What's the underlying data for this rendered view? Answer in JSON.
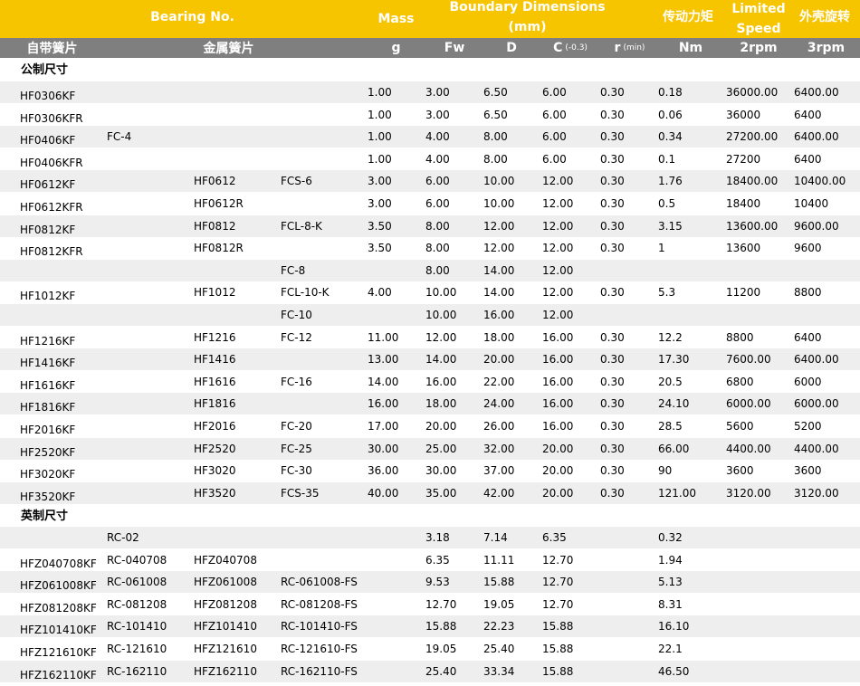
{
  "header": {
    "bearing_no": "Bearing No.",
    "mass": "Mass",
    "boundary": "Boundary Dimensions (mm)",
    "torque": "传动力矩",
    "limited_speed": "Limited Speed",
    "outer_rotation": "外壳旋转",
    "self_cage": "自带簧片",
    "metal_cage": "金属簧片",
    "unit_g": "g",
    "fw": "Fw",
    "d": "D",
    "c": "C",
    "c_tol": "(-0.3)",
    "r": "r",
    "r_min": "(min)",
    "nm": "Nm",
    "rpm2": "2rpm",
    "rpm3": "3rpm"
  },
  "sections": {
    "metric": "公制尺寸",
    "inch": "英制尺寸"
  },
  "metric_rows": [
    {
      "shade": true,
      "cells": [
        "HF0306KF",
        "",
        "",
        "",
        "1.00",
        "3.00",
        "6.50",
        "6.00",
        "0.30",
        "0.18",
        "36000.00",
        "6400.00"
      ]
    },
    {
      "shade": false,
      "cells": [
        "HF0306KFR",
        "",
        "",
        "",
        "1.00",
        "3.00",
        "6.50",
        "6.00",
        "0.30",
        "0.06",
        "36000",
        "6400"
      ]
    },
    {
      "shade": true,
      "cells": [
        "HF0406KF",
        "FC-4",
        "",
        "",
        "1.00",
        "4.00",
        "8.00",
        "6.00",
        "0.30",
        "0.34",
        "27200.00",
        "6400.00"
      ]
    },
    {
      "shade": false,
      "cells": [
        "HF0406KFR",
        "",
        "",
        "",
        "1.00",
        "4.00",
        "8.00",
        "6.00",
        "0.30",
        "0.1",
        "27200",
        "6400"
      ]
    },
    {
      "shade": true,
      "cells": [
        "HF0612KF",
        "",
        "HF0612",
        "FCS-6",
        "3.00",
        "6.00",
        "10.00",
        "12.00",
        "0.30",
        "1.76",
        "18400.00",
        "10400.00"
      ]
    },
    {
      "shade": false,
      "cells": [
        "HF0612KFR",
        "",
        "HF0612R",
        "",
        "3.00",
        "6.00",
        "10.00",
        "12.00",
        "0.30",
        "0.5",
        "18400",
        "10400"
      ]
    },
    {
      "shade": true,
      "cells": [
        "HF0812KF",
        "",
        "HF0812",
        "FCL-8-K",
        "3.50",
        "8.00",
        "12.00",
        "12.00",
        "0.30",
        "3.15",
        "13600.00",
        "9600.00"
      ]
    },
    {
      "shade": false,
      "cells": [
        "HF0812KFR",
        "",
        "HF0812R",
        "",
        "3.50",
        "8.00",
        "12.00",
        "12.00",
        "0.30",
        "1",
        "13600",
        "9600"
      ]
    },
    {
      "shade": true,
      "cells": [
        "",
        "",
        "",
        "FC-8",
        "",
        "8.00",
        "14.00",
        "12.00",
        "",
        "",
        "",
        ""
      ]
    },
    {
      "shade": false,
      "cells": [
        "HF1012KF",
        "",
        "HF1012",
        "FCL-10-K",
        "4.00",
        "10.00",
        "14.00",
        "12.00",
        "0.30",
        "5.3",
        "11200",
        "8800"
      ]
    },
    {
      "shade": true,
      "cells": [
        "",
        "",
        "",
        "FC-10",
        "",
        "10.00",
        "16.00",
        "12.00",
        "",
        "",
        "",
        ""
      ]
    },
    {
      "shade": false,
      "cells": [
        "HF1216KF",
        "",
        "HF1216",
        "FC-12",
        "11.00",
        "12.00",
        "18.00",
        "16.00",
        "0.30",
        "12.2",
        "8800",
        "6400"
      ]
    },
    {
      "shade": true,
      "cells": [
        "HF1416KF",
        "",
        "HF1416",
        "",
        "13.00",
        "14.00",
        "20.00",
        "16.00",
        "0.30",
        "17.30",
        "7600.00",
        "6400.00"
      ]
    },
    {
      "shade": false,
      "cells": [
        "HF1616KF",
        "",
        "HF1616",
        "FC-16",
        "14.00",
        "16.00",
        "22.00",
        "16.00",
        "0.30",
        "20.5",
        "6800",
        "6000"
      ]
    },
    {
      "shade": true,
      "cells": [
        "HF1816KF",
        "",
        "HF1816",
        "",
        "16.00",
        "18.00",
        "24.00",
        "16.00",
        "0.30",
        "24.10",
        "6000.00",
        "6000.00"
      ]
    },
    {
      "shade": false,
      "cells": [
        "HF2016KF",
        "",
        "HF2016",
        "FC-20",
        "17.00",
        "20.00",
        "26.00",
        "16.00",
        "0.30",
        "28.5",
        "5600",
        "5200"
      ]
    },
    {
      "shade": true,
      "cells": [
        "HF2520KF",
        "",
        "HF2520",
        "FC-25",
        "30.00",
        "25.00",
        "32.00",
        "20.00",
        "0.30",
        "66.00",
        "4400.00",
        "4400.00"
      ]
    },
    {
      "shade": false,
      "cells": [
        "HF3020KF",
        "",
        "HF3020",
        "FC-30",
        "36.00",
        "30.00",
        "37.00",
        "20.00",
        "0.30",
        "90",
        "3600",
        "3600"
      ]
    },
    {
      "shade": true,
      "cells": [
        "HF3520KF",
        "",
        "HF3520",
        "FCS-35",
        "40.00",
        "35.00",
        "42.00",
        "20.00",
        "0.30",
        "121.00",
        "3120.00",
        "3120.00"
      ]
    }
  ],
  "inch_rows": [
    {
      "shade": true,
      "cells": [
        "",
        "RC-02",
        "",
        "",
        "",
        "3.18",
        "7.14",
        "6.35",
        "",
        "0.32",
        "",
        ""
      ]
    },
    {
      "shade": false,
      "cells": [
        "HFZ040708KF",
        "RC-040708",
        "HFZ040708",
        "",
        "",
        "6.35",
        "11.11",
        "12.70",
        "",
        "1.94",
        "",
        ""
      ]
    },
    {
      "shade": true,
      "cells": [
        "HFZ061008KF",
        "RC-061008",
        "HFZ061008",
        "RC-061008-FS",
        "",
        "9.53",
        "15.88",
        "12.70",
        "",
        "5.13",
        "",
        ""
      ]
    },
    {
      "shade": false,
      "cells": [
        "HFZ081208KF",
        "RC-081208",
        "HFZ081208",
        "RC-081208-FS",
        "",
        "12.70",
        "19.05",
        "12.70",
        "",
        "8.31",
        "",
        ""
      ]
    },
    {
      "shade": true,
      "cells": [
        "HFZ101410KF",
        "RC-101410",
        "HFZ101410",
        "RC-101410-FS",
        "",
        "15.88",
        "22.23",
        "15.88",
        "",
        "16.10",
        "",
        ""
      ]
    },
    {
      "shade": false,
      "cells": [
        "HFZ121610KF",
        "RC-121610",
        "HFZ121610",
        "RC-121610-FS",
        "",
        "19.05",
        "25.40",
        "15.88",
        "",
        "22.1",
        "",
        ""
      ]
    },
    {
      "shade": true,
      "cells": [
        "HFZ162110KF",
        "RC-162110",
        "HFZ162110",
        "RC-162110-FS",
        "",
        "25.40",
        "33.34",
        "15.88",
        "",
        "46.50",
        "",
        ""
      ]
    }
  ]
}
